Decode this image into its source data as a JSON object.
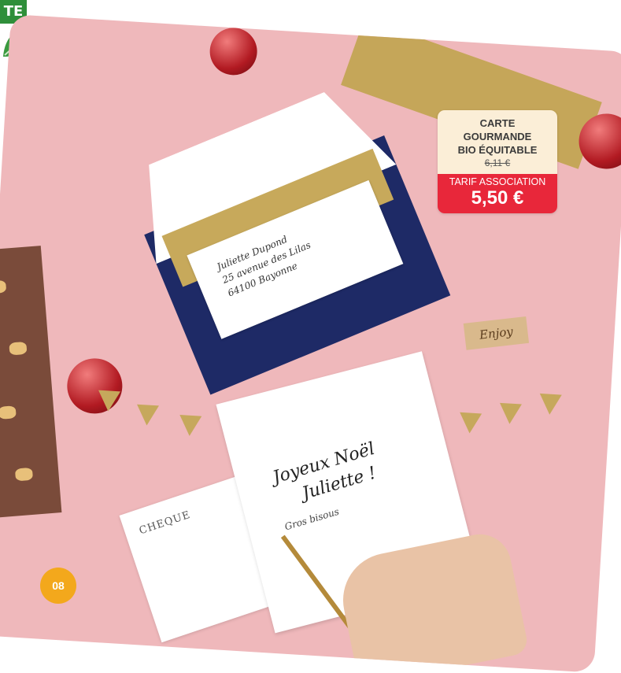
{
  "badge": {
    "text": "TE",
    "color": "#2f8f3a"
  },
  "icons": [
    "leaf-icon"
  ],
  "envelope": {
    "address_lines": [
      "Juliette Dupond",
      "25 avenue des Lilas",
      "64100 Bayonne"
    ]
  },
  "card": {
    "greeting_line1": "Joyeux Noël",
    "greeting_line2": "Juliette !",
    "signature": "Gros bisous"
  },
  "cheque": {
    "label": "CHEQUE"
  },
  "tag": {
    "text": "Enjoy"
  },
  "price_tag": {
    "line1": "CARTE",
    "line2": "GOURMANDE",
    "line3": "BIO ÉQUITABLE",
    "old_price": "6,11 €",
    "association_label": "TARIF ASSOCIATION",
    "price": "5,50 €",
    "accent_color": "#e8273a"
  },
  "page_number": "08",
  "colors": {
    "background": "#efb8bb",
    "envelope": "#1e2a66",
    "gold": "#c7a95b",
    "page_badge": "#f3a81c"
  }
}
